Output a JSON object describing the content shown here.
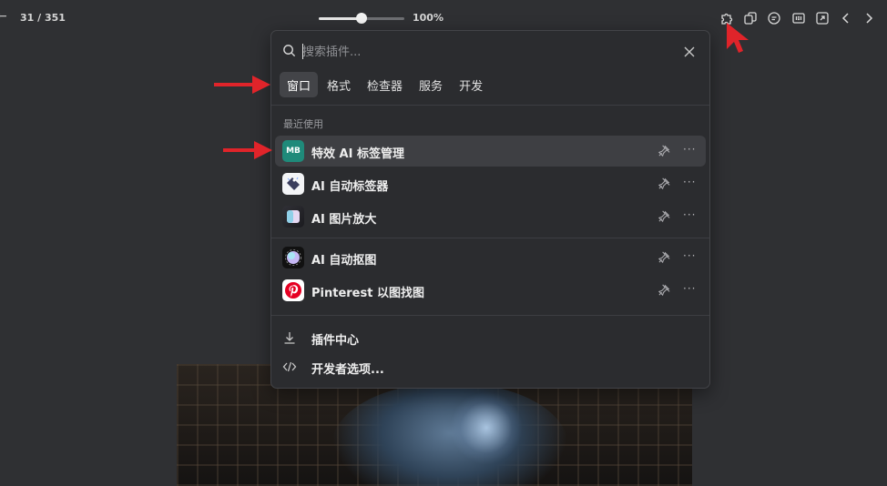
{
  "topbar": {
    "pager": "31 / 351",
    "zoom_label": "100%",
    "zoom_fraction": 0.5,
    "icons": [
      "back-arrow-icon",
      "puzzle-icon",
      "copy-icon",
      "comment-icon",
      "actual-size-icon",
      "expand-icon",
      "chevron-left-icon",
      "chevron-right-icon"
    ]
  },
  "popup": {
    "search_placeholder": "搜索插件...",
    "tabs": [
      {
        "label": "窗口",
        "active": true
      },
      {
        "label": "格式",
        "active": false
      },
      {
        "label": "检查器",
        "active": false
      },
      {
        "label": "服务",
        "active": false
      },
      {
        "label": "开发",
        "active": false
      }
    ],
    "section_label": "最近使用",
    "recent_items": [
      {
        "icon_text": "MB",
        "name": "特效 AI 标签管理"
      },
      {
        "name": "AI 自动标签器"
      },
      {
        "name": "AI 图片放大"
      }
    ],
    "other_items": [
      {
        "name": "AI 自动抠图"
      },
      {
        "name": "Pinterest 以图找图"
      }
    ],
    "footer": [
      {
        "label": "插件中心",
        "icon": "download-icon"
      },
      {
        "label": "开发者选项...",
        "icon": "code-icon"
      }
    ]
  },
  "colors": {
    "background": "#2f3033",
    "popup": "#2b2c2f",
    "annotation_arrow": "#e0242a",
    "mb_icon": "#1f8a7a"
  }
}
